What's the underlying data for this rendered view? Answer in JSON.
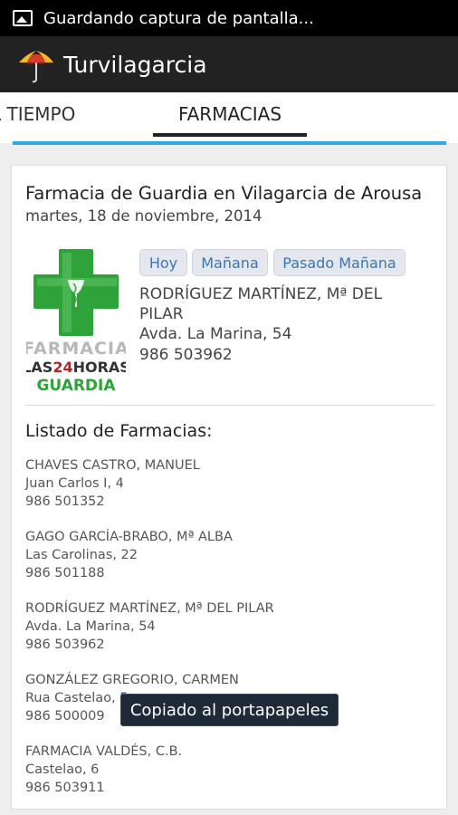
{
  "status_bar": {
    "notification": "Guardando captura de pantalla..."
  },
  "action_bar": {
    "title": "Turvilagarcia"
  },
  "tabs": [
    {
      "label": "L TIEMPO"
    },
    {
      "label": "FARMACIAS",
      "selected": true
    }
  ],
  "guard": {
    "heading": "Farmacia de Guardia en Vilagarcia de Arousa",
    "date": "martes, 18 de noviembre, 2014",
    "buttons": {
      "today": "Hoy",
      "tomorrow": "Mañana",
      "day_after": "Pasado Mañana"
    },
    "name": "RODRÍGUEZ MARTÍNEZ, Mª DEL PILAR",
    "address": "Avda. La Marina, 54",
    "phone": "986 503962"
  },
  "logo": {
    "line1": "FARMACIA",
    "line2a": "LAS",
    "line2b": "24",
    "line2c": "HORAS",
    "line3": "GUARDIA"
  },
  "list": {
    "title": "Listado de Farmacias:",
    "items": [
      {
        "name": "CHAVES CASTRO, MANUEL",
        "address": "Juan Carlos I, 4",
        "phone": "986 501352"
      },
      {
        "name": "GAGO GARCÍA-BRABO, Mª ALBA",
        "address": "Las Carolinas, 22",
        "phone": "986 501188"
      },
      {
        "name": "RODRÍGUEZ MARTÍNEZ, Mª DEL PILAR",
        "address": "Avda. La Marina, 54",
        "phone": "986 503962"
      },
      {
        "name": "GONZÁLEZ GREGORIO, CARMEN",
        "address": "Rua Castelao, 5",
        "phone": "986 500009"
      },
      {
        "name": "FARMACIA VALDÉS, C.B.",
        "address": "Castelao, 6",
        "phone": "986 503911"
      }
    ]
  },
  "toast": "Copiado al portapapeles",
  "colors": {
    "accent": "#34a6e0",
    "pharmacy_green": "#2ea33a",
    "button_text": "#3876b5",
    "logo_red": "#b4232a"
  },
  "icons": {
    "status": "image-icon",
    "app": "umbrella-icon"
  }
}
